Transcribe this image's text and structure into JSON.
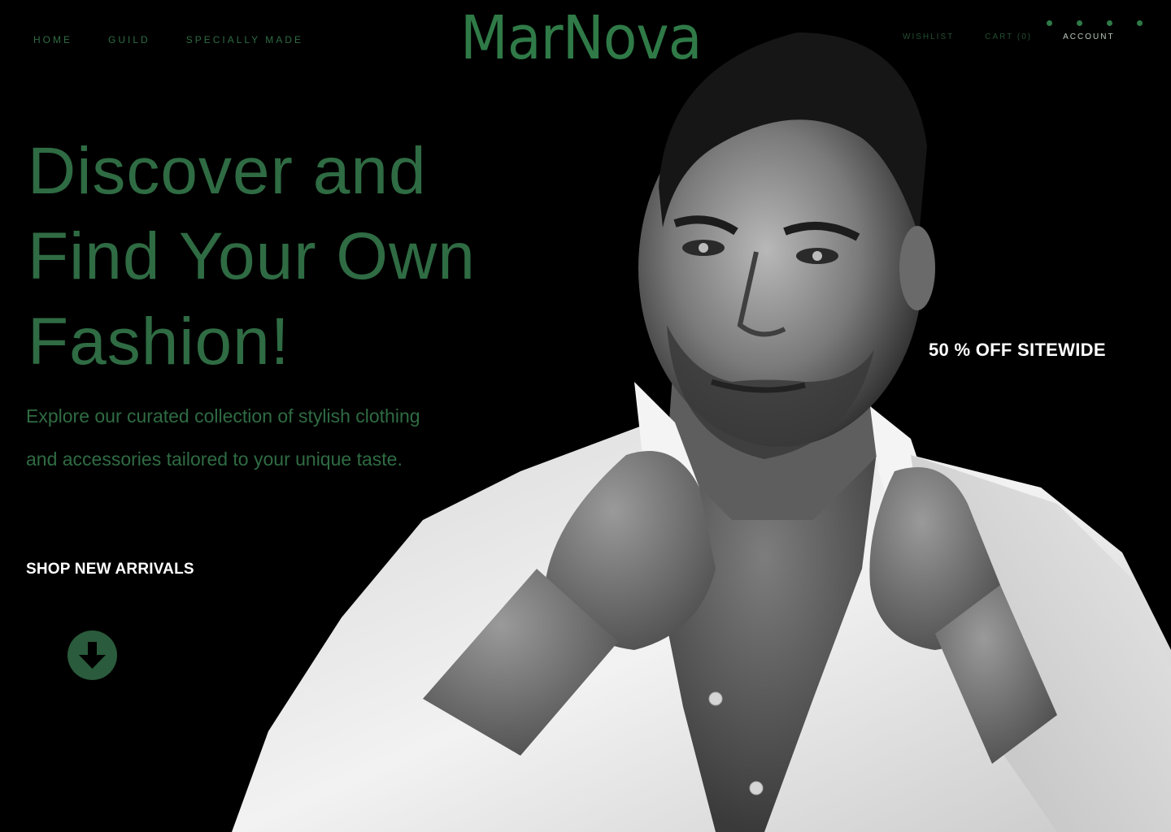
{
  "brand": {
    "logo": "MarNova",
    "accent_color": "#2f6b43"
  },
  "nav": {
    "left": [
      {
        "label": "HOME"
      },
      {
        "label": "GUILD"
      },
      {
        "label": "SPECIALLY MADE"
      }
    ],
    "right": [
      {
        "label": "WISHLIST"
      },
      {
        "label": "CART (0)"
      },
      {
        "label": "ACCOUNT"
      }
    ],
    "carousel_dots": 4
  },
  "hero": {
    "headline_lines": [
      "Discover and",
      "Find Your Own",
      "Fashion!"
    ],
    "subtitle": "Explore our curated collection of stylish clothing and accessories tailored to your unique taste.",
    "cta_label": "SHOP NEW ARRIVALS",
    "scroll_icon": "arrow-down-icon",
    "promo": "50 % OFF SITEWIDE",
    "image": "black-and-white photo of man in white shirt holding his collar"
  }
}
